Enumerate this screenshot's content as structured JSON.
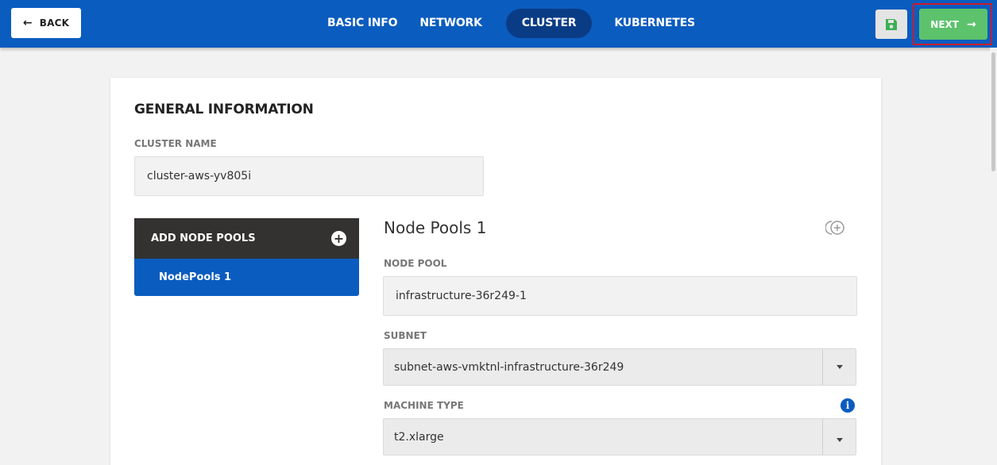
{
  "header": {
    "back_label": "BACK",
    "tabs": [
      {
        "label": "BASIC INFO",
        "active": false
      },
      {
        "label": "NETWORK",
        "active": false
      },
      {
        "label": "CLUSTER",
        "active": true
      },
      {
        "label": "KUBERNETES",
        "active": false
      }
    ],
    "save_icon": "floppy-disk-icon",
    "next_label": "NEXT",
    "colors": {
      "bar": "#0b5cbf",
      "active_tab": "#0a3c86",
      "next": "#5cc26c",
      "highlight": "#cc1b2b"
    }
  },
  "general": {
    "title": "GENERAL INFORMATION",
    "cluster_name_label": "CLUSTER NAME",
    "cluster_name_value": "cluster-aws-yv805i"
  },
  "node_pools": {
    "add_label": "ADD NODE POOLS",
    "items": [
      {
        "label": "NodePools 1",
        "selected": true
      }
    ],
    "detail_title": "Node Pools 1",
    "node_pool_label": "NODE POOL",
    "node_pool_value": "infrastructure-36r249-1",
    "subnet_label": "SUBNET",
    "subnet_value": "subnet-aws-vmktnl-infrastructure-36r249",
    "machine_type_label": "MACHINE TYPE",
    "machine_type_value": "t2.xlarge"
  }
}
